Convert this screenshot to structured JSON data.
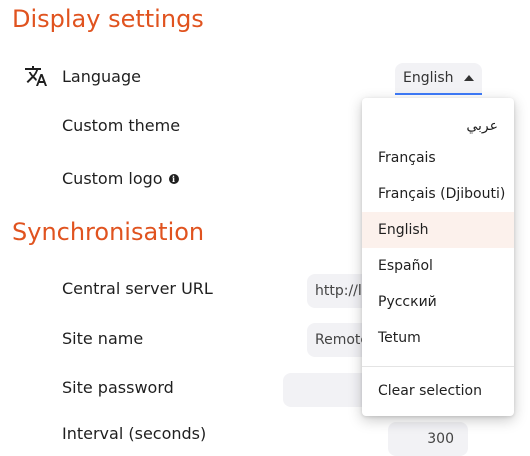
{
  "display_settings": {
    "heading": "Display settings",
    "language_label": "Language",
    "custom_theme_label": "Custom theme",
    "custom_logo_label": "Custom logo",
    "info_icon_glyph": "i",
    "language_value": "English"
  },
  "synchronisation": {
    "heading": "Synchronisation",
    "central_server_url_label": "Central server URL",
    "central_server_url_value": "http://lo",
    "site_name_label": "Site name",
    "site_name_value": "Remote",
    "site_password_label": "Site password",
    "interval_label": "Interval (seconds)",
    "interval_value": "300"
  },
  "language_menu": {
    "options": [
      "عربي",
      "Français",
      "Français (Djibouti)",
      "English",
      "Español",
      "Русский",
      "Tetum"
    ],
    "selected": "English",
    "clear_label": "Clear selection"
  },
  "colors": {
    "heading": "#e0531f",
    "select_underline": "#3e7bfa",
    "selected_option_bg": "#fcf1ec",
    "field_bg": "#f2f2f5"
  },
  "icons": {
    "language": "translate-icon",
    "info": "info-icon",
    "dropdown": "caret-up-icon"
  }
}
